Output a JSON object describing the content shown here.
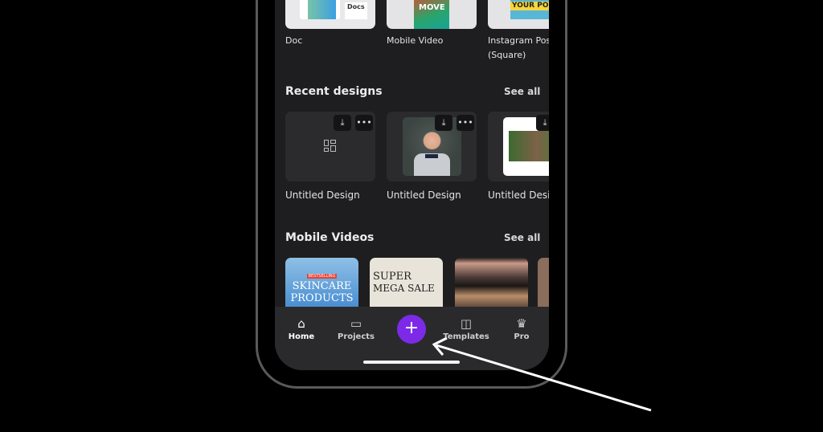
{
  "top_row": [
    {
      "label": "Doc",
      "thumb_text": "Docs"
    },
    {
      "label": "Mobile Video",
      "thumb_text": "MOVE"
    },
    {
      "label": "Instagram Post (Square)",
      "label_line1": "Instagram Post",
      "label_line2": "(Square)",
      "thumb_text": "YOUR POST"
    }
  ],
  "recent": {
    "title": "Recent designs",
    "see_all": "See all",
    "items": [
      {
        "label": "Untitled Design"
      },
      {
        "label": "Untitled Design"
      },
      {
        "label": "Untitled Design"
      }
    ]
  },
  "videos": {
    "title": "Mobile Videos",
    "see_all": "See all",
    "items": [
      {
        "line1": "BESTSELLING",
        "line2": "SKINCARE",
        "line3": "PRODUCTS"
      },
      {
        "line1": "SUPER",
        "line2": "MEGA SALE"
      },
      {},
      {}
    ]
  },
  "nav": {
    "home": "Home",
    "projects": "Projects",
    "create": "+",
    "templates": "Templates",
    "pro": "Pro"
  },
  "colors": {
    "accent": "#7d2ae8",
    "screen_bg": "#1e1e20",
    "nav_bg": "#2a2a2c"
  }
}
